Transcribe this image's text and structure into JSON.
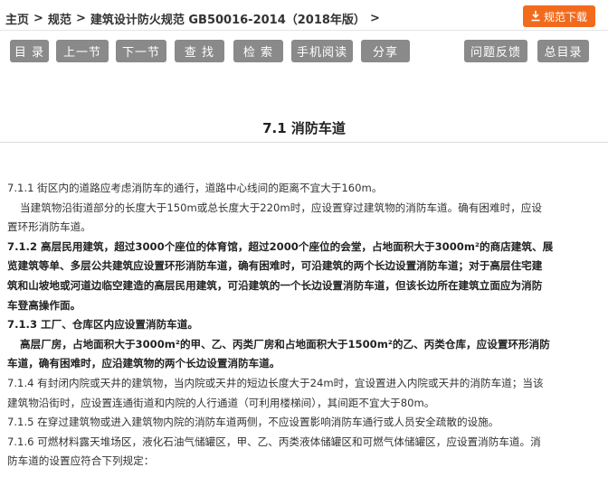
{
  "breadcrumb": [
    "主页",
    "规范",
    "建筑设计防火规范 GB50016-2014（2018年版）"
  ],
  "download_button": "规范下载",
  "toolbar": {
    "contents": "目 录",
    "prev": "上一节",
    "next": "下一节",
    "find": "查 找",
    "search": "检 索",
    "mobile": "手机阅读",
    "share": "分享",
    "feedback": "问题反馈",
    "all_contents": "总目录"
  },
  "section_title": "7.1  消防车道",
  "article_lines": [
    "7.1.1 街区内的道路应考虑消防车的通行，道路中心线间的距离不宜大于160m。",
    "当建筑物沿街道部分的长度大于150m或总长度大于220m时，应设置穿过建筑物的消防车道。确有困难时，应设",
    "置环形消防车道。",
    "7.1.2 高层民用建筑，超过3000个座位的体育馆，超过2000个座位的会堂，占地面积大于3000m²的商店建筑、展",
    "览建筑等单、多层公共建筑应设置环形消防车道，确有困难时，可沿建筑的两个长边设置消防车道；对于高层住宅建",
    "筑和山坡地或河道边临空建造的高层民用建筑，可沿建筑的一个长边设置消防车道，但该长边所在建筑立面应为消防",
    "车登高操作面。",
    "7.1.3 工厂、仓库区内应设置消防车道。",
    "高层厂房，占地面积大于3000m²的甲、乙、丙类厂房和占地面积大于1500m²的乙、丙类仓库，应设置环形消防",
    "车道，确有困难时，应沿建筑物的两个长边设置消防车道。",
    "7.1.4 有封闭内院或天井的建筑物，当内院或天井的短边长度大于24m时，宜设置进入内院或天井的消防车道；当该",
    "建筑物沿街时，应设置连通街道和内院的人行通道（可利用楼梯间），其间距不宜大于80m。",
    "7.1.5 在穿过建筑物或进入建筑物内院的消防车道两侧，不应设置影响消防车通行或人员安全疏散的设施。",
    "7.1.6 可燃材料露天堆场区，液化石油气储罐区，甲、乙、丙类液体储罐区和可燃气体储罐区，应设置消防车道。消",
    "防车道的设置应符合下列规定："
  ],
  "colors": {
    "accent": "#f26b1d",
    "button_gray": "#8a8a8a"
  }
}
